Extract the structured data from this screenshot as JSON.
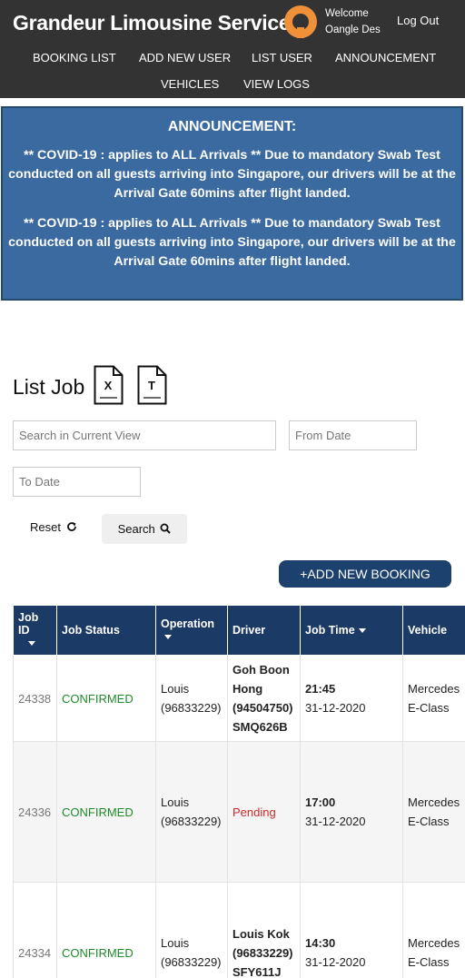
{
  "header": {
    "brand": "Grandeur Limousine Service",
    "welcome": "Welcome",
    "user": "Oangle Des",
    "logout": "Log Out",
    "logo_color": "#f0913a"
  },
  "nav": {
    "items": [
      "BOOKING LIST",
      "ADD NEW USER",
      "LIST USER",
      "ANNOUNCEMENT",
      "VEHICLES",
      "VIEW LOGS"
    ]
  },
  "announcement": {
    "heading": "ANNOUNCEMENT:",
    "messages": [
      "** COVID-19 : applies to ALL Arrivals ** Due to mandatory Swab Test conducted on all guests arriving into Singapore, our drivers will be at the Arrival Gate 60mins after flight landed.",
      "** COVID-19 : applies to ALL Arrivals ** Due to mandatory Swab Test conducted on all guests arriving into Singapore, our drivers will be at the Arrival Gate 60mins after flight landed."
    ]
  },
  "list": {
    "title": "List Job",
    "export_icons": [
      "X",
      "T"
    ]
  },
  "filters": {
    "search_placeholder": "Search in Current View",
    "from_placeholder": "From Date",
    "to_placeholder": "To Date",
    "reset_label": "Reset",
    "search_label": "Search",
    "add_label": "+ADD NEW BOOKING"
  },
  "table": {
    "headers": [
      "Job ID",
      "Job Status",
      "Operation",
      "Driver",
      "Job Time",
      "Vehicle"
    ],
    "rows": [
      {
        "id": "24338",
        "status": "CONFIRMED",
        "operation_name": "Louis",
        "operation_phone": "(96833229)",
        "driver_name": "Goh Boon Hong",
        "driver_phone": "(94504750)",
        "driver_plate": "SMQ626B",
        "time": "21:45",
        "date": "31-12-2020",
        "vehicle_make": "Mercedes",
        "vehicle_model": "E-Class"
      },
      {
        "id": "24336",
        "status": "CONFIRMED",
        "operation_name": "Louis",
        "operation_phone": "(96833229)",
        "driver_status": "Pending",
        "time": "17:00",
        "date": "31-12-2020",
        "vehicle_make": "Mercedes",
        "vehicle_model": "E-Class"
      },
      {
        "id": "24334",
        "status": "CONFIRMED",
        "operation_name": "Louis",
        "operation_phone": "(96833229)",
        "driver_name": "Louis Kok",
        "driver_phone": "(96833229)",
        "driver_plate": "SFY611J",
        "time": "14:30",
        "date": "31-12-2020",
        "vehicle_make": "Mercedes",
        "vehicle_model": "E-Class"
      }
    ]
  },
  "colors": {
    "header_bg": "#333333",
    "announcement_bg": "#3a6aa0",
    "table_header_bg": "#1c3a66",
    "status_confirmed": "#1e8a2a",
    "status_pending": "#d02a2a"
  }
}
